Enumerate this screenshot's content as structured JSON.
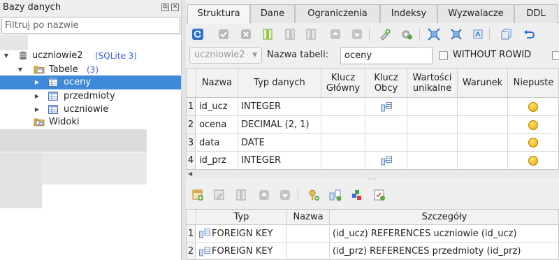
{
  "left_panel": {
    "title": "Bazy danych",
    "filter_placeholder": "Filtruj po nazwie",
    "database": {
      "name": "uczniowie2",
      "badge": "(SQLite 3)"
    },
    "tables_node": {
      "label": "Tabele",
      "count": "(3)"
    },
    "tables": [
      {
        "label": "oceny",
        "selected": true
      },
      {
        "label": "przedmioty",
        "selected": false
      },
      {
        "label": "uczniowie",
        "selected": false
      }
    ],
    "views_node": {
      "label": "Widoki"
    }
  },
  "tabs": [
    "Struktura",
    "Dane",
    "Ograniczenia",
    "Indeksy",
    "Wyzwalacze",
    "DDL"
  ],
  "active_tab": "Struktura",
  "toolbar_icons": [
    "refresh-icon",
    "commit-icon",
    "rollback-icon",
    "add-column-icon",
    "add-column-before-icon",
    "delete-column-icon",
    "move-up-icon",
    "move-down-icon",
    "add-index-icon",
    "add-trigger-icon",
    "expand-icon",
    "collapse-icon",
    "import-icon",
    "copy-icon",
    "undo-icon"
  ],
  "table_form": {
    "database_combo": "uczniowie2",
    "name_label": "Nazwa tabeli:",
    "name_value": "oceny",
    "without_rowid_label": "WITHOUT ROWID",
    "without_rowid_checked": false
  },
  "columns_grid": {
    "headers": [
      "Nazwa",
      "Typ danych",
      "Klucz Główny",
      "Klucz Obcy",
      "Wartości unikalne",
      "Warunek",
      "Niepuste"
    ],
    "rows": [
      {
        "num": "1",
        "name": "id_ucz",
        "type": "INTEGER",
        "pk": false,
        "fk": true,
        "unique": false,
        "check": "",
        "not_null": true
      },
      {
        "num": "2",
        "name": "ocena",
        "type": "DECIMAL (2, 1)",
        "pk": false,
        "fk": false,
        "unique": false,
        "check": "",
        "not_null": true
      },
      {
        "num": "3",
        "name": "data",
        "type": "DATE",
        "pk": false,
        "fk": false,
        "unique": false,
        "check": "",
        "not_null": true
      },
      {
        "num": "4",
        "name": "id_prz",
        "type": "INTEGER",
        "pk": false,
        "fk": true,
        "unique": false,
        "check": "",
        "not_null": true
      }
    ]
  },
  "constraints_toolbar_icons": [
    "add-constraint-icon",
    "edit-constraint-icon",
    "delete-constraint-icon",
    "move-up-icon",
    "move-down-icon",
    "add-pk-icon",
    "add-fk-icon",
    "add-unique-icon",
    "add-check-icon"
  ],
  "constraints_grid": {
    "headers": [
      "Typ",
      "Nazwa",
      "Szczegóły"
    ],
    "rows": [
      {
        "num": "1",
        "type": "FOREIGN KEY",
        "name": "",
        "details": "(id_ucz) REFERENCES uczniowie (id_ucz)"
      },
      {
        "num": "2",
        "type": "FOREIGN KEY",
        "name": "",
        "details": "(id_prz) REFERENCES przedmioty (id_prz)"
      }
    ]
  },
  "colors": {
    "selection": "#3f8ad8",
    "badge_blue": "#3d5ddc",
    "panel_bg": "#efefef"
  }
}
